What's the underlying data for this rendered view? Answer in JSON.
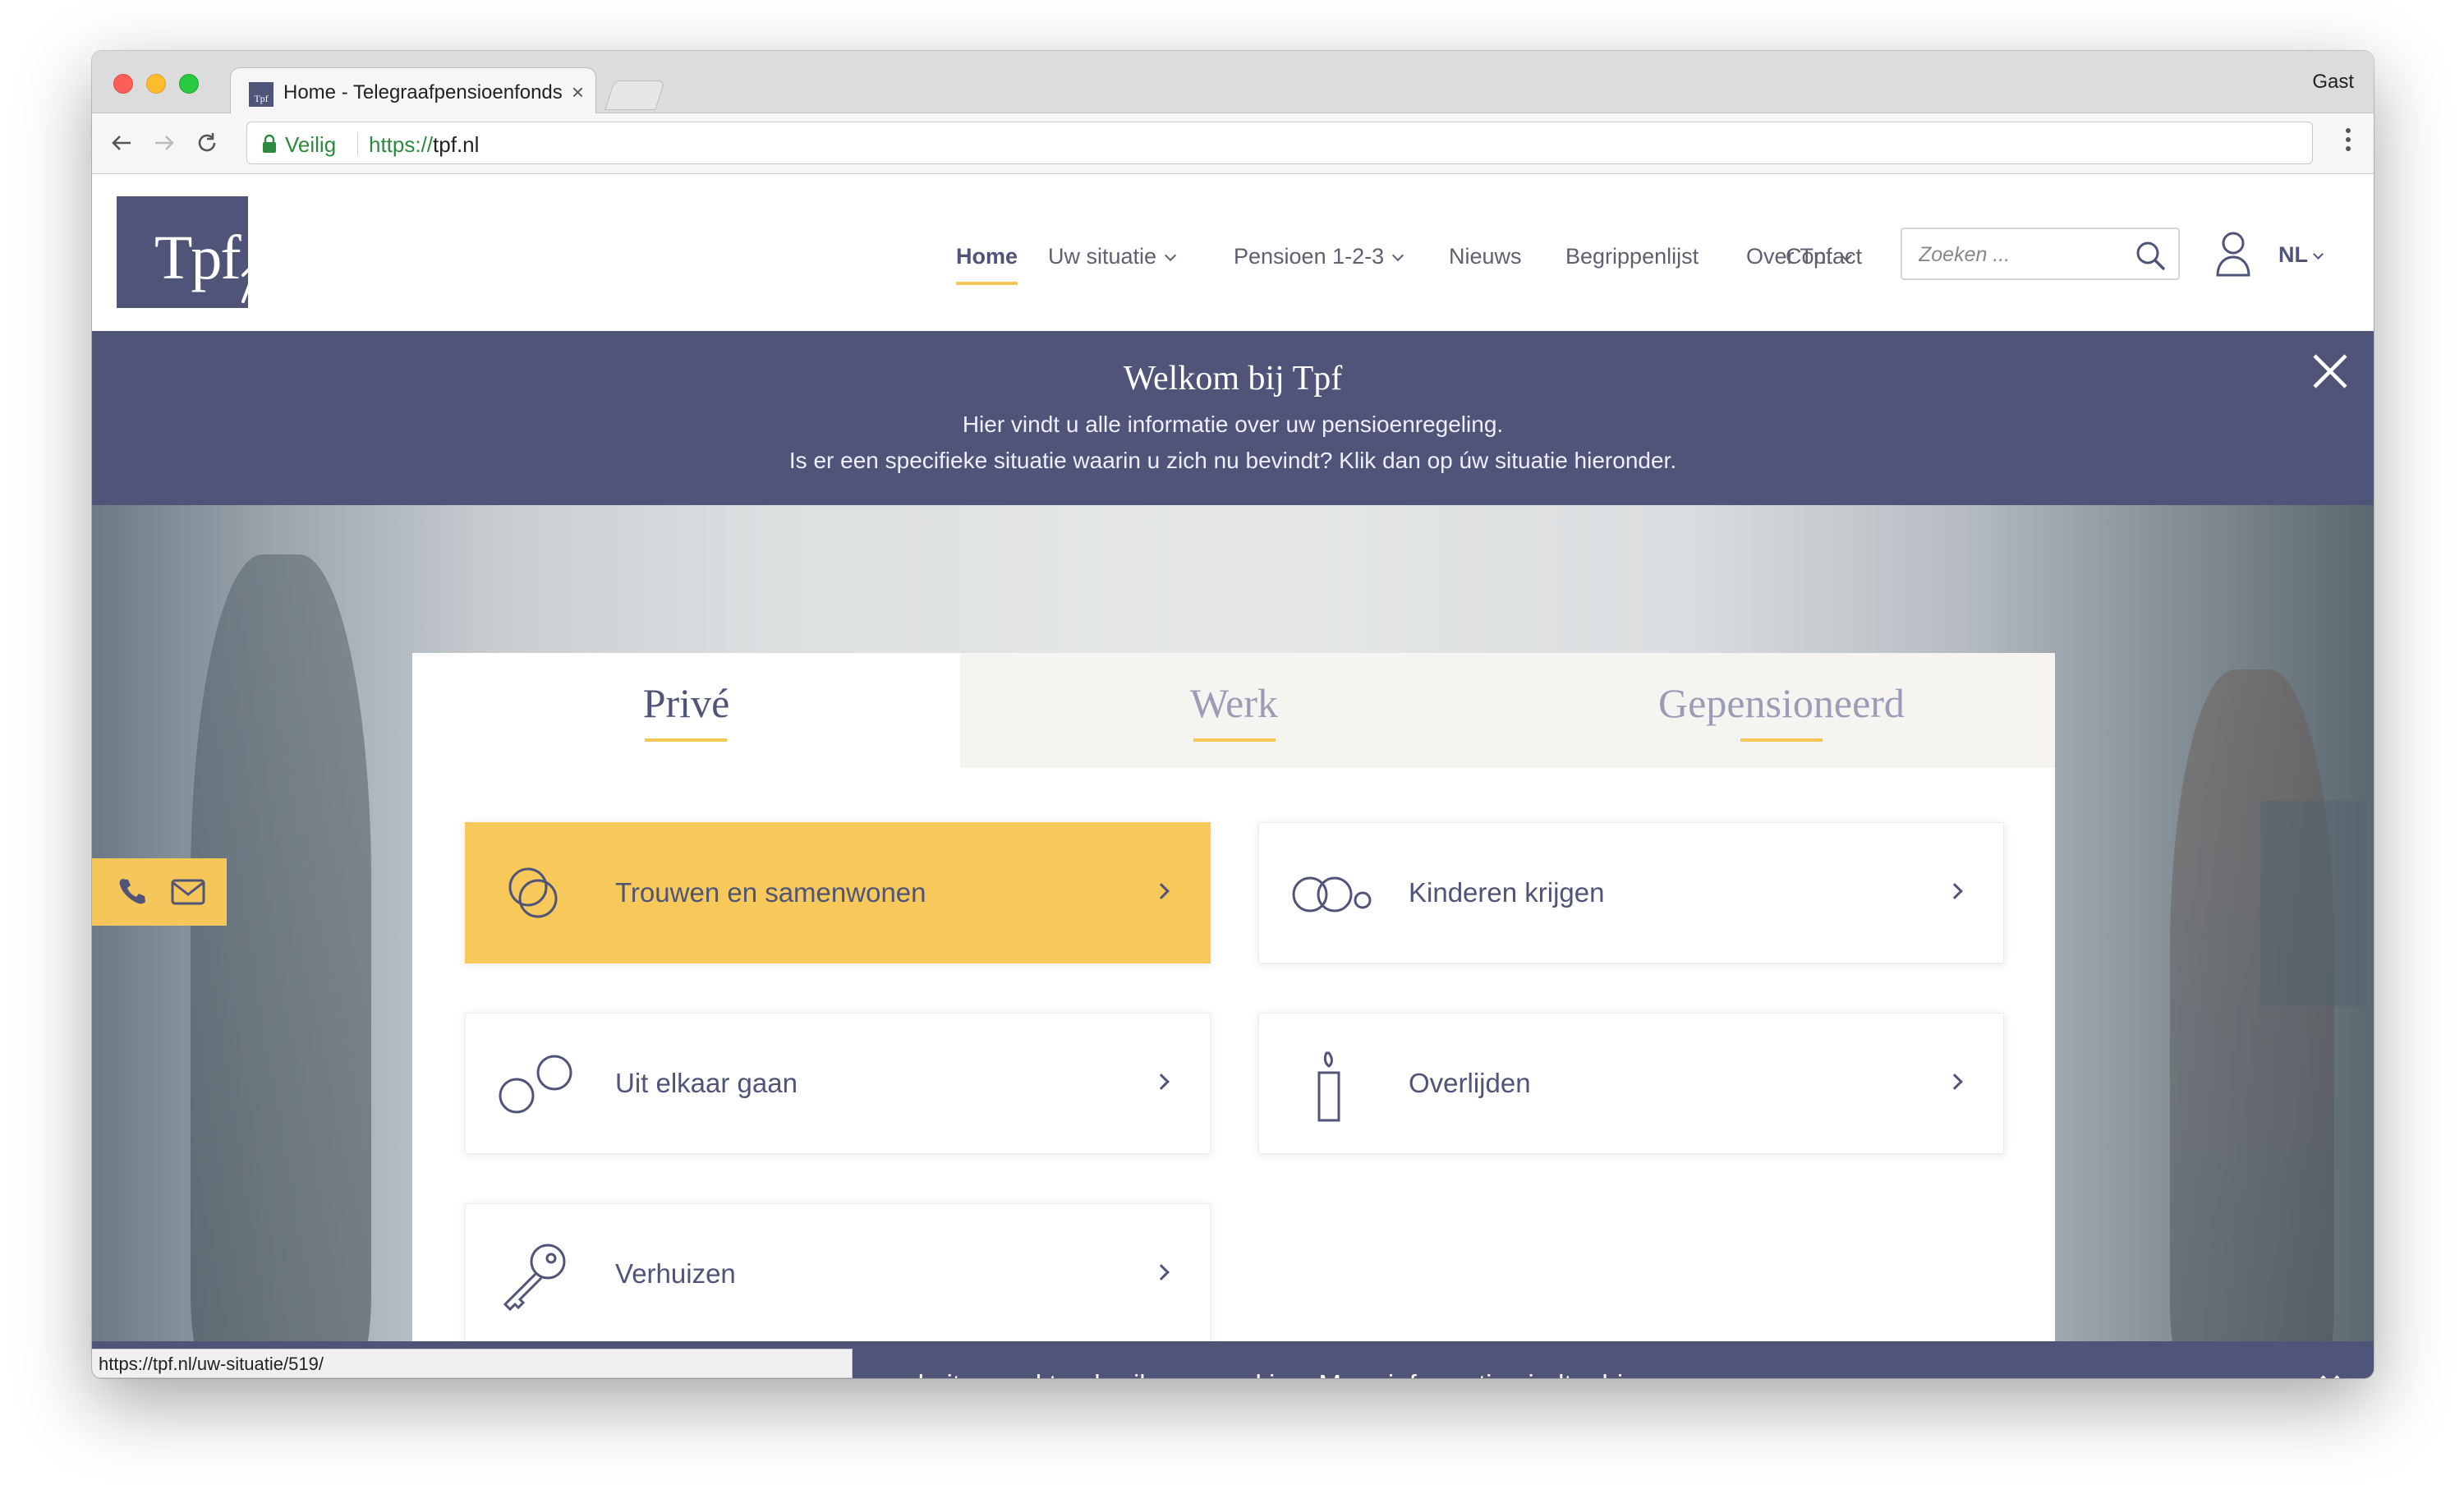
{
  "browser": {
    "tab_title": "Home - Telegraafpensioenfonds",
    "tab_favicon_text": "Tpf",
    "profile_label": "Gast",
    "secure_label": "Veilig",
    "url_scheme": "https://",
    "url_host": "tpf.nl",
    "status_url": "https://tpf.nl/uw-situatie/519/"
  },
  "header": {
    "logo_text": "Tpf",
    "nav": [
      {
        "label": "Home",
        "active": true
      },
      {
        "label": "Uw situatie",
        "dropdown": true
      },
      {
        "label": "Pensioen 1-2-3",
        "dropdown": true
      },
      {
        "label": "Nieuws"
      },
      {
        "label": "Begrippenlijst"
      },
      {
        "label": "Over Tpf",
        "dropdown": true
      },
      {
        "label": "Contact"
      }
    ],
    "search_placeholder": "Zoeken ...",
    "language": "NL"
  },
  "welcome": {
    "title": "Welkom bij Tpf",
    "line1": "Hier vindt u alle informatie over uw pensioenregeling.",
    "line2": "Is er een specifieke situatie waarin u zich nu bevindt? Klik dan op úw situatie hieronder."
  },
  "situations": {
    "tabs": [
      {
        "label": "Privé",
        "active": true
      },
      {
        "label": "Werk",
        "active": false
      },
      {
        "label": "Gepensioneerd",
        "active": false
      }
    ],
    "cards": [
      {
        "label": "Trouwen en samenwonen",
        "icon": "rings-icon",
        "highlighted": true
      },
      {
        "label": "Kinderen krijgen",
        "icon": "family-circles-icon"
      },
      {
        "label": "Uit elkaar gaan",
        "icon": "separated-circles-icon"
      },
      {
        "label": "Overlijden",
        "icon": "candle-icon"
      },
      {
        "label": "Verhuizen",
        "icon": "key-icon"
      }
    ]
  },
  "cookie": {
    "text": "Deze website maakt gebruik van cookies. Meer informatie vindt u hier."
  },
  "colors": {
    "brand": "#4f5478",
    "accent": "#f5c75a"
  }
}
